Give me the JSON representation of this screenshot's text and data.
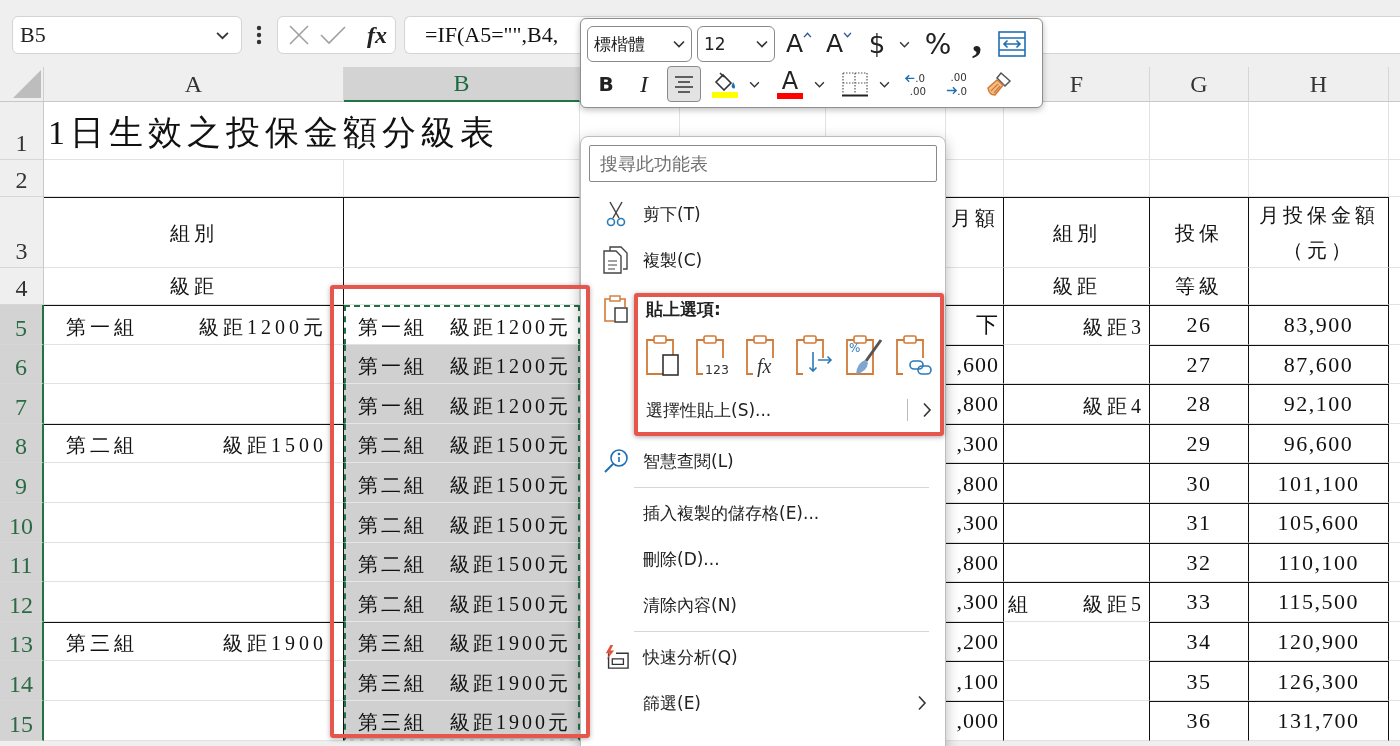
{
  "formula_bar": {
    "name_box": "B5",
    "function_button": "fx",
    "formula": "=IF(A5=\"\",B4,"
  },
  "mini_toolbar": {
    "rows": [
      [
        {
          "kind": "font",
          "value": "標楷體"
        },
        {
          "kind": "size",
          "value": "12"
        },
        {
          "kind": "grow-font",
          "label": "A"
        },
        {
          "kind": "shrink-font",
          "label": "A"
        },
        {
          "kind": "currency",
          "label": "$"
        },
        {
          "kind": "caret"
        },
        {
          "kind": "percent",
          "label": "%"
        },
        {
          "kind": "comma",
          "label": ","
        },
        {
          "kind": "merge"
        }
      ],
      [
        {
          "kind": "bold",
          "label": "B",
          "on": false
        },
        {
          "kind": "italic",
          "label": "I",
          "on": false
        },
        {
          "kind": "center",
          "on": true
        },
        {
          "kind": "fill-color",
          "color": "#ffff00"
        },
        {
          "kind": "caret"
        },
        {
          "kind": "font-color",
          "label": "A",
          "color": "#ff0000"
        },
        {
          "kind": "caret"
        },
        {
          "kind": "borders"
        },
        {
          "kind": "caret"
        },
        {
          "kind": "increase-decimal",
          "top": ".0",
          "bottom": ".00"
        },
        {
          "kind": "decrease-decimal",
          "top": ".00",
          "bottom": ".0"
        },
        {
          "kind": "painter"
        }
      ]
    ]
  },
  "sheet": {
    "columns": [
      {
        "label": "A",
        "selected": false
      },
      {
        "label": "B",
        "selected": true
      },
      {
        "label": "F",
        "selected": false
      },
      {
        "label": "G",
        "selected": false
      },
      {
        "label": "H",
        "selected": false
      }
    ],
    "rows": [
      {
        "label": "1",
        "kind": "title",
        "selected": false,
        "active": false,
        "cells": {
          "column_a": "1日生效之投保金額分級表"
        }
      },
      {
        "label": "2",
        "kind": "blank",
        "selected": false,
        "active": false
      },
      {
        "label": "3",
        "kind": "header",
        "selected": false,
        "active": false,
        "cells": {
          "column_a": "組別",
          "column_e": "月額",
          "column_f": "組別",
          "column_g": "投保",
          "column_h": "月投保金額（元）"
        }
      },
      {
        "label": "4",
        "kind": "header",
        "selected": false,
        "active": false,
        "cells": {
          "column_a": "級距",
          "column_f": "級距",
          "column_g": "等級"
        }
      },
      {
        "label": "5",
        "kind": "data",
        "selected": true,
        "active": true,
        "cells": {
          "column_a": [
            "第一組",
            "級距1200元"
          ],
          "column_b": "第一組　級距1200元",
          "column_e": "下",
          "column_f": "級距3",
          "column_g": "26",
          "column_h": "83,900"
        }
      },
      {
        "label": "6",
        "kind": "data",
        "selected": true,
        "active": false,
        "cells": {
          "column_b": "第一組　級距1200元",
          "column_e": ",600",
          "column_g": "27",
          "column_h": "87,600"
        }
      },
      {
        "label": "7",
        "kind": "data",
        "selected": true,
        "active": false,
        "cells": {
          "column_b": "第一組　級距1200元",
          "column_e": ",800",
          "column_f": "級距4",
          "column_g": "28",
          "column_h": "92,100"
        }
      },
      {
        "label": "8",
        "kind": "data",
        "selected": true,
        "active": false,
        "cells": {
          "column_a": [
            "第二組",
            "級距1500"
          ],
          "column_b": "第二組　級距1500元",
          "column_e": ",300",
          "column_g": "29",
          "column_h": "96,600"
        }
      },
      {
        "label": "9",
        "kind": "data",
        "selected": true,
        "active": false,
        "cells": {
          "column_b": "第二組　級距1500元",
          "column_e": ",800",
          "column_g": "30",
          "column_h": "101,100"
        }
      },
      {
        "label": "10",
        "kind": "data",
        "selected": true,
        "active": false,
        "cells": {
          "column_b": "第二組　級距1500元",
          "column_e": ",300",
          "column_g": "31",
          "column_h": "105,600"
        }
      },
      {
        "label": "11",
        "kind": "data",
        "selected": true,
        "active": false,
        "cells": {
          "column_b": "第二組　級距1500元",
          "column_e": ",800",
          "column_g": "32",
          "column_h": "110,100"
        }
      },
      {
        "label": "12",
        "kind": "data",
        "selected": true,
        "active": false,
        "cells": {
          "column_b": "第二組　級距1500元",
          "column_e": ",300",
          "column_f": [
            "組",
            "級距5"
          ],
          "column_g": "33",
          "column_h": "115,500"
        }
      },
      {
        "label": "13",
        "kind": "data",
        "selected": true,
        "active": false,
        "cells": {
          "column_a": [
            "第三組",
            "級距1900"
          ],
          "column_b": "第三組　級距1900元",
          "column_e": ",200",
          "column_g": "34",
          "column_h": "120,900"
        }
      },
      {
        "label": "14",
        "kind": "data",
        "selected": true,
        "active": false,
        "cells": {
          "column_b": "第三組　級距1900元",
          "column_e": ",100",
          "column_g": "35",
          "column_h": "126,300"
        }
      },
      {
        "label": "15",
        "kind": "data",
        "selected": true,
        "active": false,
        "cells": {
          "column_b": "第三組　級距1900元",
          "column_e": ",000",
          "column_g": "36",
          "column_h": "131,700"
        }
      }
    ]
  },
  "context_menu": {
    "search_placeholder": "搜尋此功能表",
    "items": [
      {
        "kind": "cut",
        "label": "剪下(T)"
      },
      {
        "kind": "copy",
        "label": "複製(C)"
      },
      {
        "kind": "paste-options",
        "label": "貼上選項:",
        "options": [
          {
            "kind": "paste"
          },
          {
            "kind": "values",
            "label": "123"
          },
          {
            "kind": "formulas",
            "label": "fx"
          },
          {
            "kind": "transpose"
          },
          {
            "kind": "formatting",
            "label": "%"
          },
          {
            "kind": "link"
          }
        ],
        "submenu_label": "選擇性貼上(S)..."
      },
      {
        "kind": "smart-lookup",
        "label": "智慧查閱(L)"
      },
      {
        "kind": "separator"
      },
      {
        "kind": "command",
        "label": "插入複製的儲存格(E)..."
      },
      {
        "kind": "command",
        "label": "刪除(D)..."
      },
      {
        "kind": "command",
        "label": "清除內容(N)"
      },
      {
        "kind": "separator"
      },
      {
        "kind": "quick-analysis",
        "label": "快速分析(Q)"
      },
      {
        "kind": "submenu",
        "label": "篩選(E)"
      }
    ]
  }
}
